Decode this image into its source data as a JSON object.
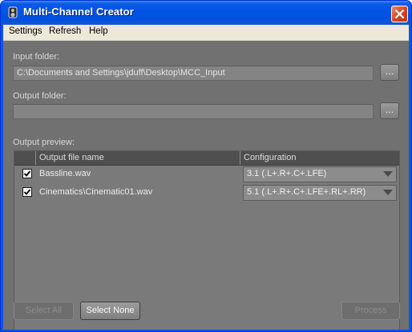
{
  "window": {
    "title": "Multi-Channel Creator",
    "app_icon": "speaker-icon",
    "close_icon": "close-icon"
  },
  "menu": {
    "items": [
      "Settings",
      "Refresh",
      "Help"
    ]
  },
  "input": {
    "label": "Input folder:",
    "value": "C:\\Documents and Settings\\jduff\\Desktop\\MCC_Input",
    "browse_label": "..."
  },
  "output": {
    "label": "Output folder:",
    "value": "",
    "browse_label": "..."
  },
  "preview": {
    "label": "Output preview:",
    "columns": [
      "Output file name",
      "Configuration"
    ],
    "rows": [
      {
        "checked": true,
        "file": "Bassline.wav",
        "config": "3.1 (.L+.R+.C+.LFE)"
      },
      {
        "checked": true,
        "file": "Cinematics\\Cinematic01.wav",
        "config": "5.1 (.L+.R+.C+.LFE+.RL+.RR)"
      }
    ]
  },
  "buttons": {
    "select_all": "Select All",
    "select_none": "Select None",
    "process": "Process"
  },
  "colors": {
    "titlebar": "#0054e3",
    "client_bg": "#717171",
    "close_button": "#d5431b"
  }
}
